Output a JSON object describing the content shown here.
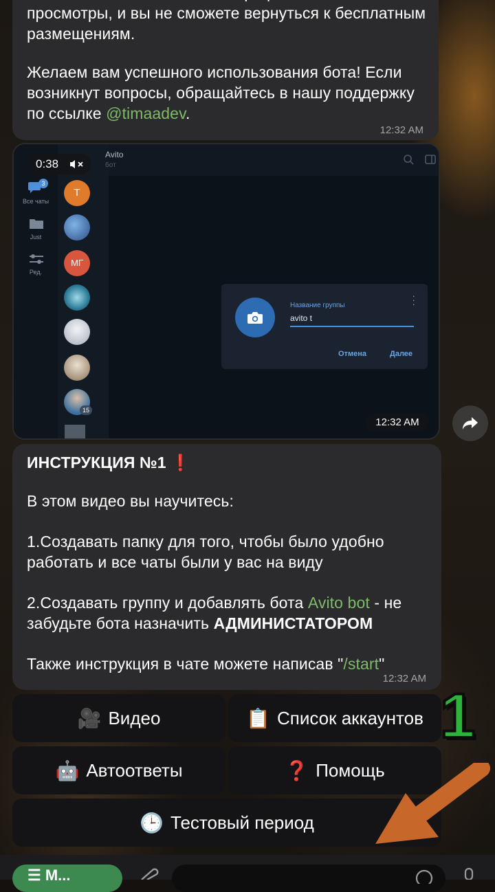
{
  "message_top": {
    "text_part1": "вас использовать платный тариф с оплатой за просмотры, и вы не сможете вернуться к бесплатным размещениям.",
    "text_part2a": "Желаем вам успешного использования бота! Если возникнут вопросы, обращайтесь в нашу поддержку по ссылке ",
    "support_link": "@timaadev",
    "text_part2b": ".",
    "time": "12:32 AM"
  },
  "video": {
    "duration": "0:38",
    "time": "12:32 AM",
    "app_title": "Avito",
    "app_subtitle": "бот",
    "rail": [
      {
        "label": "Все чаты",
        "badge": "3"
      },
      {
        "label": "Just"
      },
      {
        "label": "Ред."
      }
    ],
    "avatars": [
      {
        "text": "T",
        "color": "#e07b2b"
      },
      {
        "text": "",
        "color": "#3a6fb0"
      },
      {
        "text": "МГ",
        "color": "#d9563e"
      },
      {
        "text": "",
        "color": "#2f7f9a"
      },
      {
        "text": "",
        "color": "#c9ced6"
      },
      {
        "text": "",
        "color": "#b9a58a"
      },
      {
        "text": "",
        "color": "#7db0d8",
        "badge": "15"
      }
    ],
    "dialog": {
      "label": "Название группы",
      "value": "avito t",
      "cancel": "Отмена",
      "next": "Далее"
    }
  },
  "message_instr": {
    "title": "ИНСТРУКЦИЯ №1 ",
    "title_emoji": "❗",
    "line1": "В этом видео вы научитесь:",
    "line2": "1.Создавать папку для того, чтобы было удобно работать и все чаты были у вас на виду",
    "line3a": "2.Создавать группу и добавлять бота ",
    "line3_link": "Avito bot",
    "line3b": " - не забудьте бота назначить ",
    "line3_bold": "АДМИНИСТАТОРОМ",
    "line4a": "Также инструкция в чате можете написав \"",
    "line4_cmd": "/start",
    "line4b": "\"",
    "time": "12:32 AM"
  },
  "keyboard": [
    {
      "emoji": "🎥",
      "label": "Видео"
    },
    {
      "emoji": "📋",
      "label": "Список аккаунтов"
    },
    {
      "emoji": "🤖",
      "label": "Автоответы"
    },
    {
      "emoji": "❓",
      "label": "Помощь"
    },
    {
      "emoji": "🕒",
      "label": "Тестовый период"
    }
  ],
  "overlay_number": "1",
  "bottom": {
    "menu_label": "☰ М..."
  },
  "colors": {
    "bubble": "#2b2a2c",
    "link": "#7dba6a",
    "keyboard_button": "#141416",
    "arrow": "#c8672a",
    "overlay_number": "#2bb33a"
  }
}
